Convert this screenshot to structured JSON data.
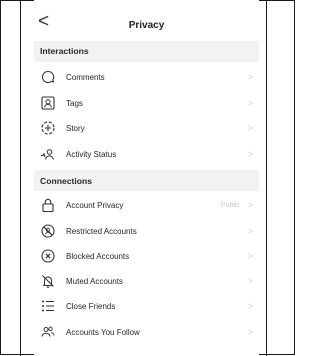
{
  "header": {
    "back_glyph": "<",
    "title": "Privacy"
  },
  "sections": {
    "interactions": {
      "label": "Interactions",
      "items": [
        {
          "label": "Comments",
          "icon": "comment-bubble-icon"
        },
        {
          "label": "Tags",
          "icon": "tag-person-icon"
        },
        {
          "label": "Story",
          "icon": "story-add-icon"
        },
        {
          "label": "Activity Status",
          "icon": "activity-status-icon"
        }
      ]
    },
    "connections": {
      "label": "Connections",
      "items": [
        {
          "label": "Account Privacy",
          "value": "Public",
          "icon": "lock-icon"
        },
        {
          "label": "Restricted Accounts",
          "icon": "restricted-icon"
        },
        {
          "label": "Blocked Accounts",
          "icon": "blocked-icon"
        },
        {
          "label": "Muted Accounts",
          "icon": "muted-bell-icon"
        },
        {
          "label": "Close Friends",
          "icon": "close-friends-list-icon"
        },
        {
          "label": "Accounts You Follow",
          "icon": "accounts-following-icon"
        }
      ]
    }
  },
  "chevron_glyph": ">",
  "colors": {
    "section_background": "#f2f2f2",
    "text": "#262626",
    "chevron": "#d0d0d0"
  }
}
